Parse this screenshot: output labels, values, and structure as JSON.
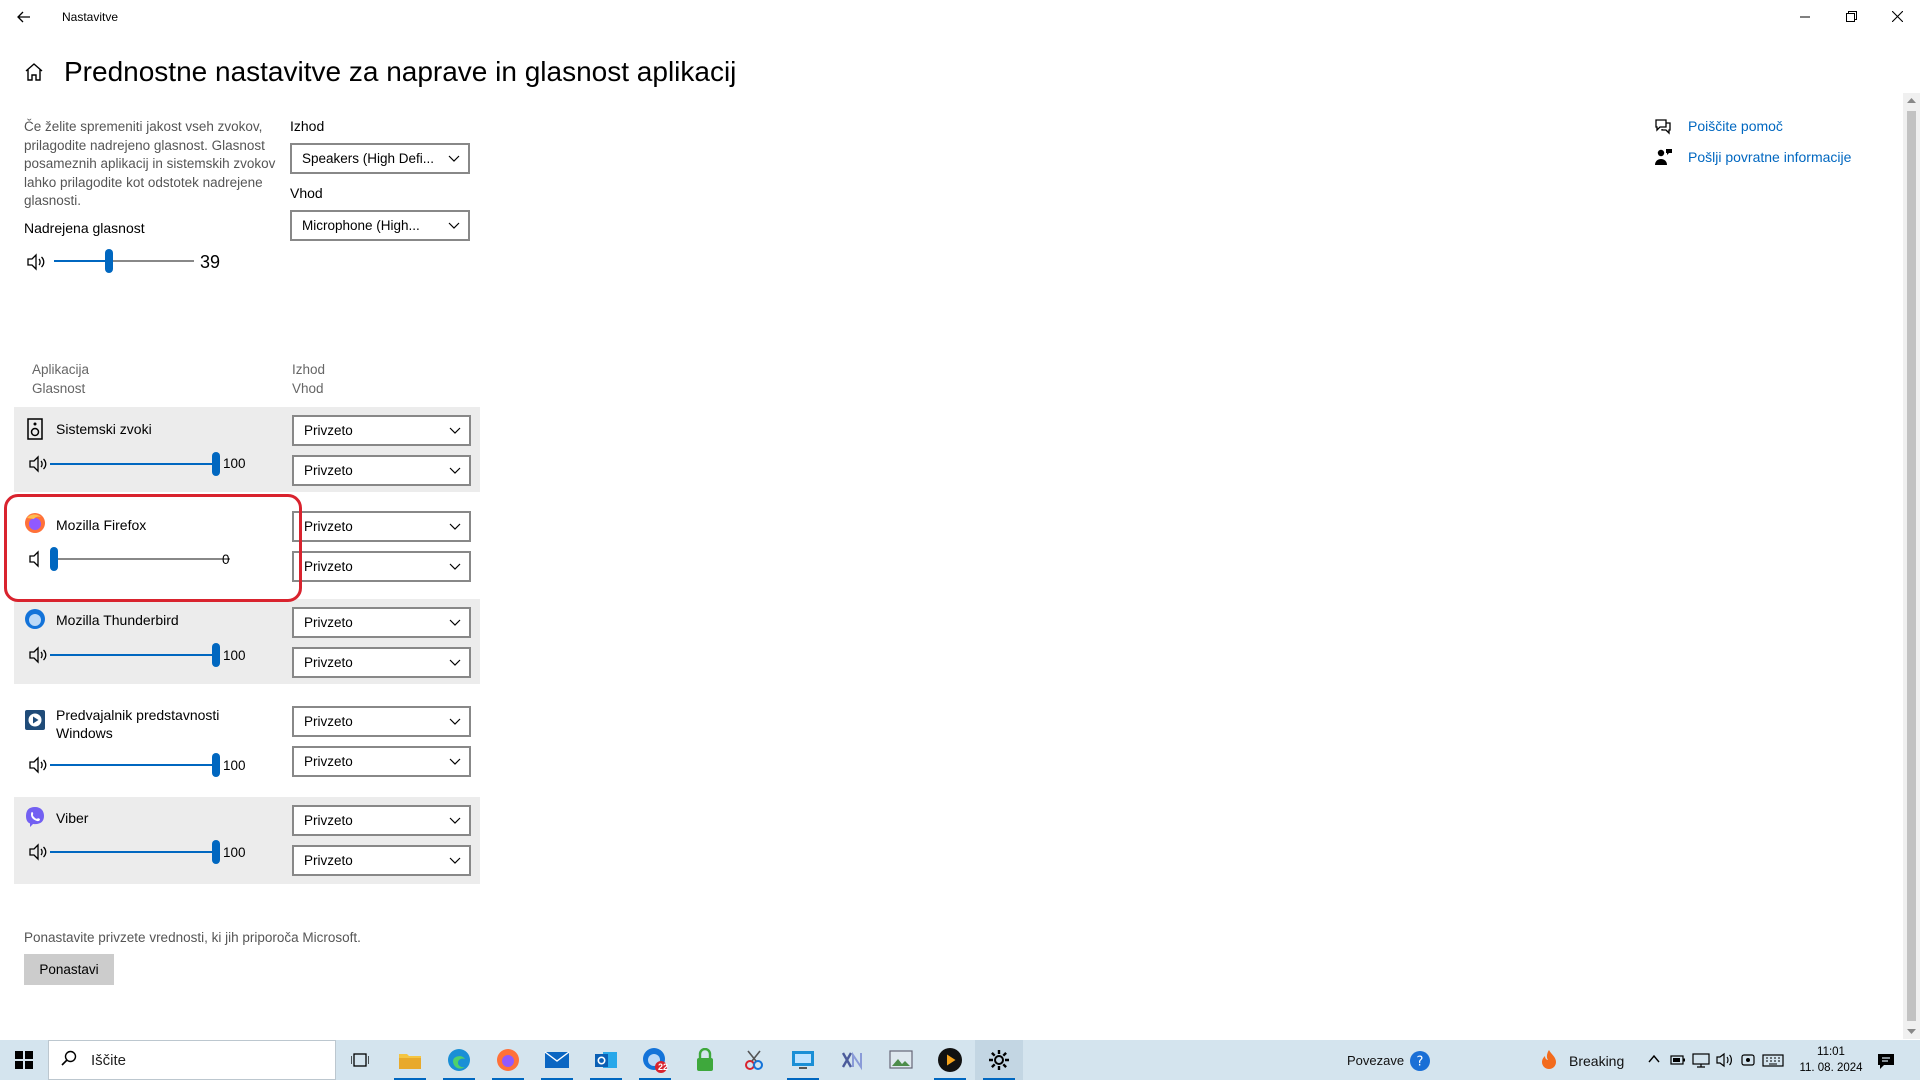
{
  "window": {
    "title": "Nastavitve"
  },
  "page": {
    "title": "Prednostne nastavitve za naprave in glasnost aplikacij"
  },
  "master": {
    "description": "Če želite spremeniti jakost vseh zvokov, prilagodite nadrejeno glasnost. Glasnost posameznih aplikacij in sistemskih zvokov lahko prilagodite kot odstotek nadrejene glasnosti.",
    "label": "Nadrejena glasnost",
    "value": "39",
    "level": 39,
    "output_label": "Izhod",
    "output_value": "Speakers (High Defi...",
    "input_label": "Vhod",
    "input_value": "Microphone (High..."
  },
  "table_headers": {
    "app": "Aplikacija",
    "volume": "Glasnost",
    "output": "Izhod",
    "input": "Vhod"
  },
  "apps": [
    {
      "name": "Sistemski zvoki",
      "value": "100",
      "level": 100,
      "output": "Privzeto",
      "input": "Privzeto",
      "icon": "speaker-box-icon"
    },
    {
      "name": "Mozilla Firefox",
      "value": "0",
      "level": 0,
      "output": "Privzeto",
      "input": "Privzeto",
      "icon": "firefox-icon"
    },
    {
      "name": "Mozilla Thunderbird",
      "value": "100",
      "level": 100,
      "output": "Privzeto",
      "input": "Privzeto",
      "icon": "thunderbird-icon"
    },
    {
      "name": "Predvajalnik predstavnosti Windows",
      "value": "100",
      "level": 100,
      "output": "Privzeto",
      "input": "Privzeto",
      "icon": "media-player-icon"
    },
    {
      "name": "Viber",
      "value": "100",
      "level": 100,
      "output": "Privzeto",
      "input": "Privzeto",
      "icon": "viber-icon"
    }
  ],
  "reset": {
    "text": "Ponastavite privzete vrednosti, ki jih priporoča Microsoft.",
    "button": "Ponastavi"
  },
  "help": {
    "get_help": "Poiščite pomoč",
    "feedback": "Pošlji povratne informacije"
  },
  "taskbar": {
    "search": "Iščite",
    "mail_badge": "22",
    "povezave": "Povezave",
    "news": "Breaking",
    "time": "11:01",
    "date": "11. 08. 2024"
  },
  "colors": {
    "accent": "#0067c0",
    "highlight": "#d9232e",
    "taskbar": "#d4e4ee"
  }
}
